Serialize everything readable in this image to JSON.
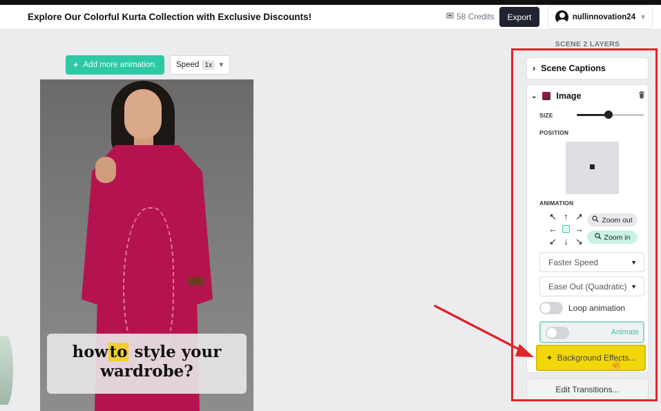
{
  "header": {
    "title": "Explore Our Colorful Kurta Collection with Exclusive Discounts!",
    "credits": "58 Credits",
    "export_label": "Export",
    "username": "nullinnovation24"
  },
  "toolbar": {
    "add_animation_label": "Add more animation.",
    "speed_label": "Speed",
    "speed_value": "1x"
  },
  "scene": {
    "caption_words": [
      "how",
      "to",
      "style",
      "your",
      "wardrobe?"
    ]
  },
  "panel": {
    "title": "SCENE 2 LAYERS",
    "scene_captions_label": "Scene Captions",
    "image_label": "Image",
    "size_label": "SIZE",
    "size_value": 0.47,
    "position_label": "POSITION",
    "animation_label": "ANIMATION",
    "zoom_out_label": "Zoom out",
    "zoom_in_label": "Zoom in",
    "speed_select": "Faster Speed",
    "easing_select": "Ease Out (Quadratic)",
    "loop_label": "Loop animation",
    "animate_label": "Animate",
    "background_effects_label": "Background Effects...",
    "edit_transitions_label": "Edit Transitions..."
  },
  "colors": {
    "accent": "#2ec8a6",
    "highlight": "#f1d70a",
    "annotation_red": "#e0242b"
  }
}
